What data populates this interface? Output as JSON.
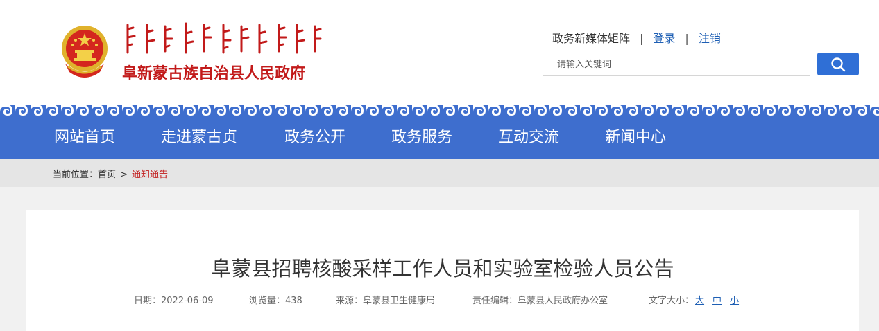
{
  "header": {
    "site_name": "阜新蒙古族自治县人民政府",
    "emblem": "national-emblem-icon",
    "mongolian_logo": "mongolian-script-logo"
  },
  "toplinks": {
    "matrix": "政务新媒体矩阵",
    "login": "登录",
    "logout": "注销",
    "separator": "|"
  },
  "search": {
    "placeholder": "请输入关键词",
    "value": "",
    "icon": "search-icon"
  },
  "nav": {
    "items": [
      {
        "label": "网站首页"
      },
      {
        "label": "走进蒙古贞"
      },
      {
        "label": "政务公开"
      },
      {
        "label": "政务服务"
      },
      {
        "label": "互动交流"
      },
      {
        "label": "新闻中心"
      }
    ]
  },
  "breadcrumb": {
    "prefix": "当前位置：",
    "home": "首页",
    "arrow": ">",
    "current": "通知通告"
  },
  "article": {
    "title": "阜蒙县招聘核酸采样工作人员和实验室检验人员公告",
    "date": "日期：2022-06-09",
    "views": "浏览量：438",
    "source": "来源：阜蒙县卫生健康局",
    "editor": "责任编辑：阜蒙县人民政府办公室",
    "font_size_label": "文字大小：",
    "font_large": "大",
    "font_medium": "中",
    "font_small": "小"
  },
  "colors": {
    "nav_bg": "#3e6ece",
    "accent_red": "#c21a1a",
    "link_blue": "#1e5fb4",
    "search_btn": "#2f6fd6"
  }
}
